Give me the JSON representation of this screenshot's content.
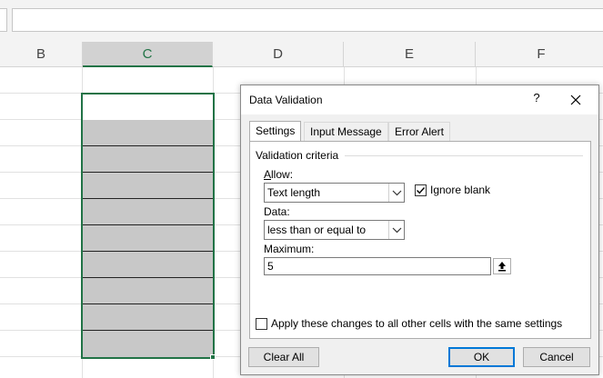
{
  "columns": [
    "B",
    "C",
    "D",
    "E",
    "F"
  ],
  "dialog": {
    "title": "Data Validation",
    "help_label": "?",
    "tabs": [
      "Settings",
      "Input Message",
      "Error Alert"
    ],
    "group_label": "Validation criteria",
    "allow": {
      "label": "Allow:",
      "value": "Text length"
    },
    "ignore_blank": {
      "label": "Ignore blank",
      "checked": true
    },
    "data": {
      "label": "Data:",
      "value": "less than or equal to"
    },
    "maximum": {
      "label": "Maximum:",
      "value": "5"
    },
    "apply_all": {
      "label": "Apply these changes to all other cells with the same settings",
      "checked": false
    },
    "buttons": {
      "clear_all": "Clear All",
      "ok": "OK",
      "cancel": "Cancel"
    }
  },
  "colors": {
    "accent_green": "#217346",
    "default_button_blue": "#0078d7"
  }
}
